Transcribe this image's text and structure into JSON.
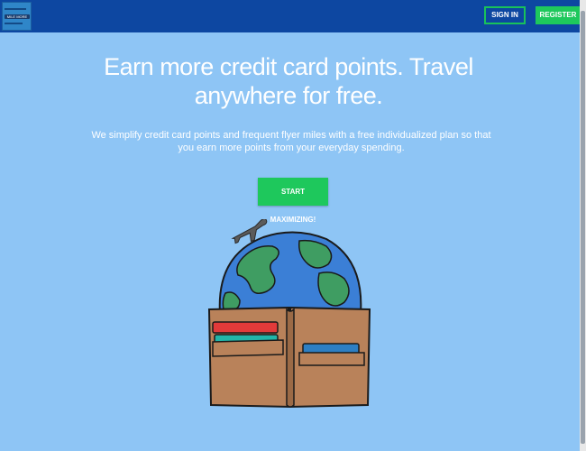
{
  "header": {
    "logo_text": "MILE MORE",
    "sign_in_label": "SIGN IN",
    "register_label": "REGISTER"
  },
  "hero": {
    "headline": "Earn more credit card points. Travel anywhere for free.",
    "subtext": "We simplify credit card points and frequent flyer miles with a free individualized plan so that you earn more points from your everyday spending.",
    "cta_label": "START MAXIMIZING!"
  },
  "illustration": {
    "icons": [
      "airplane-icon",
      "globe-icon",
      "wallet-icon"
    ]
  },
  "colors": {
    "background": "#8ec5f5",
    "navbar": "#0d47a1",
    "accent_green": "#1ec85c",
    "wallet_brown": "#b9825a",
    "globe_blue": "#3b7fd6",
    "land_green": "#3f9d62"
  }
}
